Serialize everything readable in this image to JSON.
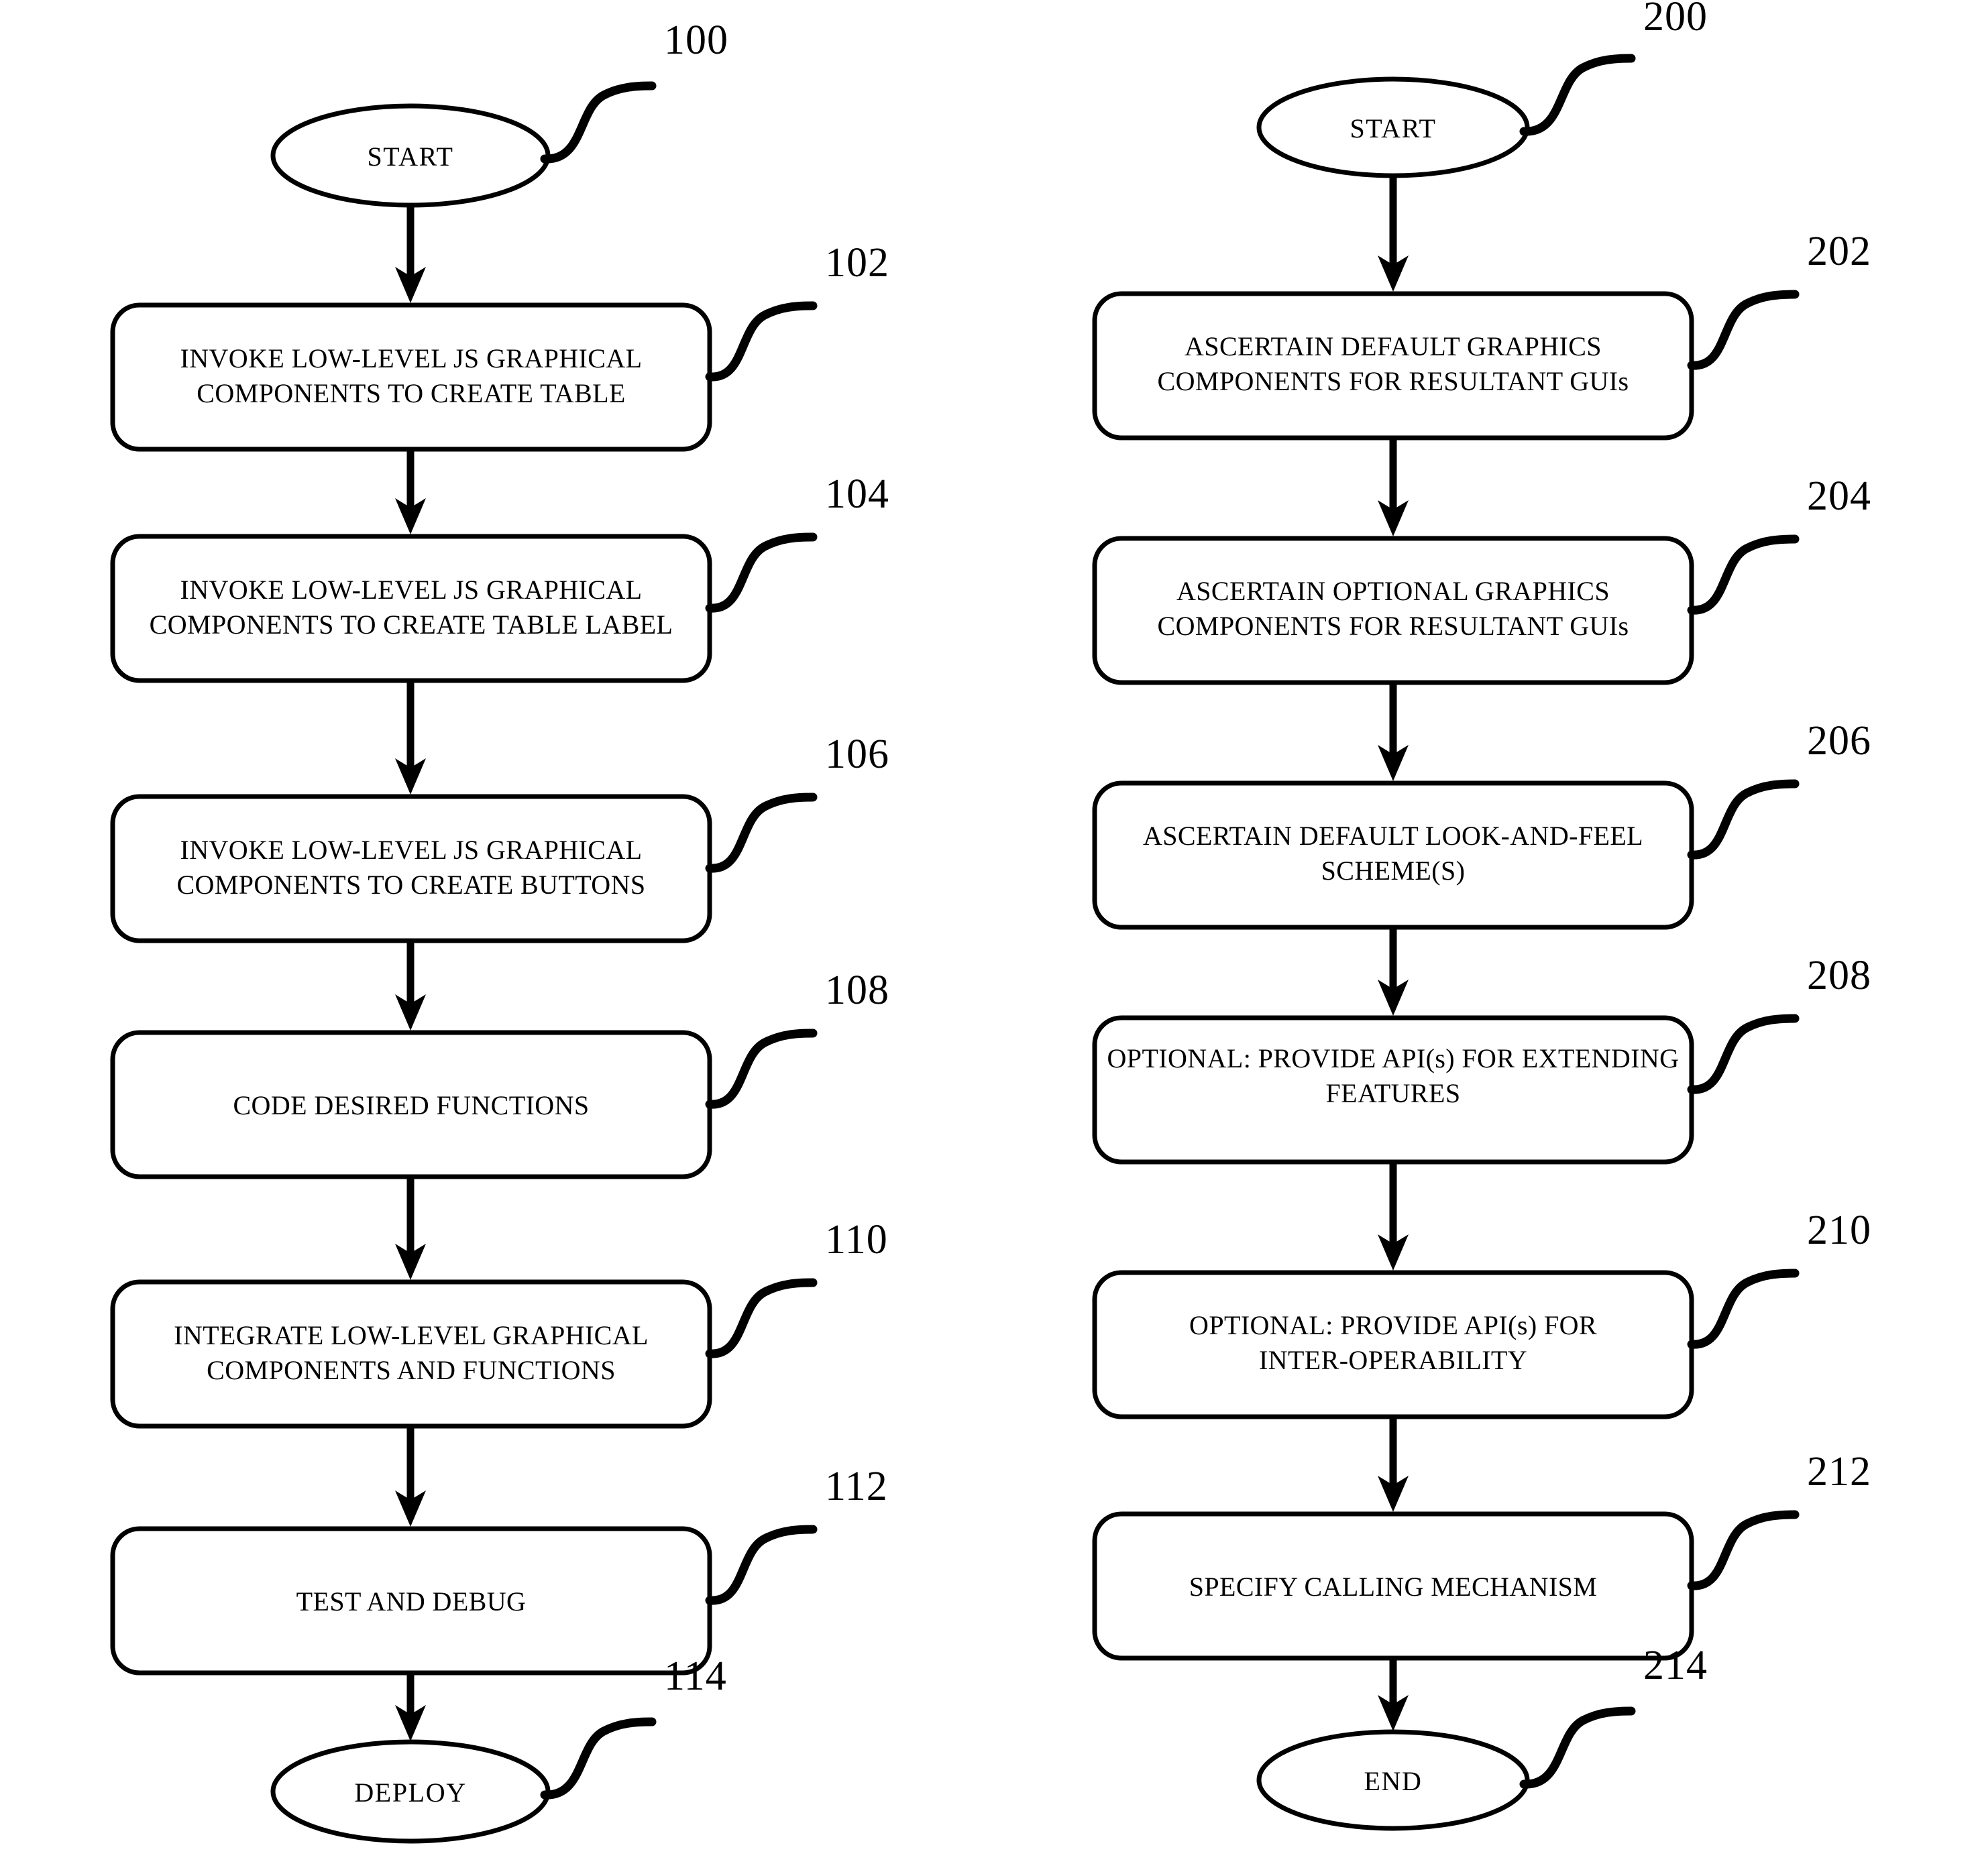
{
  "figure": {
    "title": "Patent flowchart with two process flows",
    "background_color": "#ffffff",
    "ink_color": "#000000"
  },
  "flows": [
    {
      "id": "left-flow",
      "start": {
        "ref": "100",
        "label": "START"
      },
      "steps": [
        {
          "ref": "102",
          "lines": [
            "INVOKE LOW-LEVEL JS GRAPHICAL",
            "COMPONENTS TO CREATE TABLE"
          ]
        },
        {
          "ref": "104",
          "lines": [
            "INVOKE LOW-LEVEL JS GRAPHICAL",
            "COMPONENTS TO CREATE TABLE LABEL"
          ]
        },
        {
          "ref": "106",
          "lines": [
            "INVOKE LOW-LEVEL JS GRAPHICAL",
            "COMPONENTS TO CREATE BUTTONS"
          ]
        },
        {
          "ref": "108",
          "lines": [
            "CODE DESIRED FUNCTIONS"
          ]
        },
        {
          "ref": "110",
          "lines": [
            "INTEGRATE LOW-LEVEL GRAPHICAL",
            "COMPONENTS AND FUNCTIONS"
          ]
        },
        {
          "ref": "112",
          "lines": [
            "TEST AND DEBUG"
          ]
        }
      ],
      "end": {
        "ref": "114",
        "label": "DEPLOY"
      }
    },
    {
      "id": "right-flow",
      "start": {
        "ref": "200",
        "label": "START"
      },
      "steps": [
        {
          "ref": "202",
          "lines": [
            "ASCERTAIN DEFAULT GRAPHICS",
            "COMPONENTS FOR RESULTANT GUIs"
          ]
        },
        {
          "ref": "204",
          "lines": [
            "ASCERTAIN OPTIONAL GRAPHICS",
            "COMPONENTS FOR RESULTANT GUIs"
          ]
        },
        {
          "ref": "206",
          "lines": [
            "ASCERTAIN DEFAULT LOOK-AND-FEEL",
            "SCHEME(S)"
          ]
        },
        {
          "ref": "208",
          "lines": [
            "OPTIONAL: PROVIDE API(s) FOR EXTENDING",
            "FEATURES"
          ]
        },
        {
          "ref": "210",
          "lines": [
            "OPTIONAL:  PROVIDE API(s) FOR",
            "INTER-OPERABILITY"
          ]
        },
        {
          "ref": "212",
          "lines": [
            "SPECIFY CALLING MECHANISM"
          ]
        }
      ],
      "end": {
        "ref": "214",
        "label": "END"
      }
    }
  ]
}
